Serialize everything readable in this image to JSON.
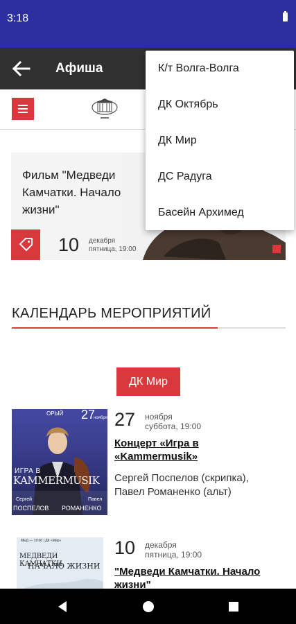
{
  "status_bar": {
    "time": "3:18"
  },
  "app_bar": {
    "title": "Афиша"
  },
  "featured": {
    "title": "Фильм \"Медведи Камчатки. Начало жизни\"",
    "day": "10",
    "month": "декабря",
    "weekday_time": "пятница, 19:00"
  },
  "calendar": {
    "heading": "КАЛЕНДАРЬ МЕРОПРИЯТИЙ",
    "selected_venue": "ДК Мир"
  },
  "events": [
    {
      "day": "27",
      "month": "ноября",
      "weekday_time": "суббота, 19:00",
      "title": "Концерт «Игра в «Kammermusik»",
      "description": "Сергей Поспелов (скрипка), Павел Романенко (альт)",
      "poster": {
        "top_left": "ОРЫЙ",
        "date_num": "27",
        "date_month": "ноября",
        "line1": "ИГРА В",
        "line2": "KAMMERMUSIK",
        "name1_first": "Сергей",
        "name1_last": "ПОСПЕЛОВ",
        "name2_first": "Павел",
        "name2_last": "РОМАНЕНКО"
      }
    },
    {
      "day": "10",
      "month": "декабря",
      "weekday_time": "пятница, 19:00",
      "title": "\"Медведи Камчатки. Начало жизни\"",
      "poster": {
        "header": "МЕД — 19:00 | ДК «Мир»",
        "line1": "МЕДВЕДИ КАМЧАТКИ.",
        "line2": "НАЧАЛО ЖИЗНИ"
      }
    }
  ],
  "dropdown": {
    "items": [
      "К/т Волга-Волга",
      "ДК Октябрь",
      "ДК Мир",
      "ДС Радуга",
      "Басейн Архимед"
    ]
  },
  "icons": {
    "back": "arrow-left-icon",
    "menu": "hamburger-menu-icon",
    "tag": "ticket-tag-icon",
    "nav_back": "triangle-back-icon",
    "nav_home": "circle-home-icon",
    "nav_recent": "square-recent-icon"
  },
  "colors": {
    "accent": "#d9393c",
    "status_bar": "#2b2fa0",
    "app_bar": "#303030"
  }
}
